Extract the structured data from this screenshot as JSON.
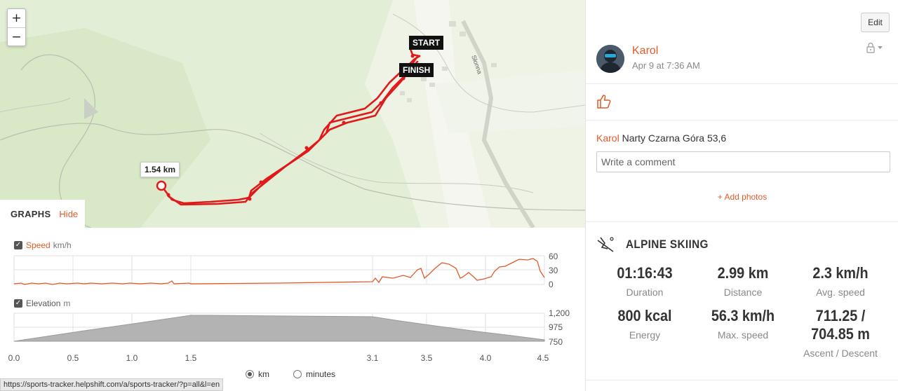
{
  "map": {
    "zoom_in": "+",
    "zoom_out": "−",
    "start_label": "START",
    "finish_label": "FINISH",
    "marker_label": "1.54 km",
    "street_label": "Słonna"
  },
  "graphs": {
    "title": "GRAPHS",
    "hide_label": "Hide",
    "speed": {
      "name": "Speed",
      "unit": "km/h",
      "ticks": [
        "60",
        "30",
        "0"
      ],
      "color": "#e05a2b"
    },
    "elevation": {
      "name": "Elevation",
      "unit": "m",
      "ticks": [
        "1,200",
        "975",
        "750"
      ]
    },
    "x_ticks": [
      "0.0",
      "0.5",
      "1.0",
      "1.5",
      "3.1",
      "3.5",
      "4.0",
      "4.5"
    ],
    "unit_km": "km",
    "unit_minutes": "minutes",
    "selected_unit": "km"
  },
  "status_url": "https://sports-tracker.helpshift.com/a/sports-tracker/?p=all&l=en",
  "sidebar": {
    "edit_label": "Edit",
    "user_name": "Karol",
    "date": "Apr 9 at 7:36 AM",
    "description_user": "Karol",
    "description_text": "Narty Czarna Góra 53,6",
    "comment_placeholder": "Write a comment",
    "add_photos": "+ Add photos",
    "sport": "ALPINE SKIING",
    "stats": {
      "duration": {
        "value": "01:16:43",
        "label": "Duration"
      },
      "distance": {
        "value": "2.99 km",
        "label": "Distance"
      },
      "avg_speed": {
        "value": "2.3 km/h",
        "label": "Avg. speed"
      },
      "energy": {
        "value": "800 kcal",
        "label": "Energy"
      },
      "max_speed": {
        "value": "56.3 km/h",
        "label": "Max. speed"
      },
      "ascent_descent": {
        "value": "711.25 / 704.85 m",
        "label": "Ascent / Descent"
      }
    }
  },
  "colors": {
    "accent": "#e05a2b",
    "route": "#e0191b",
    "map_bg": "#e6f0d8",
    "elevation_fill": "#b3b3b3"
  }
}
